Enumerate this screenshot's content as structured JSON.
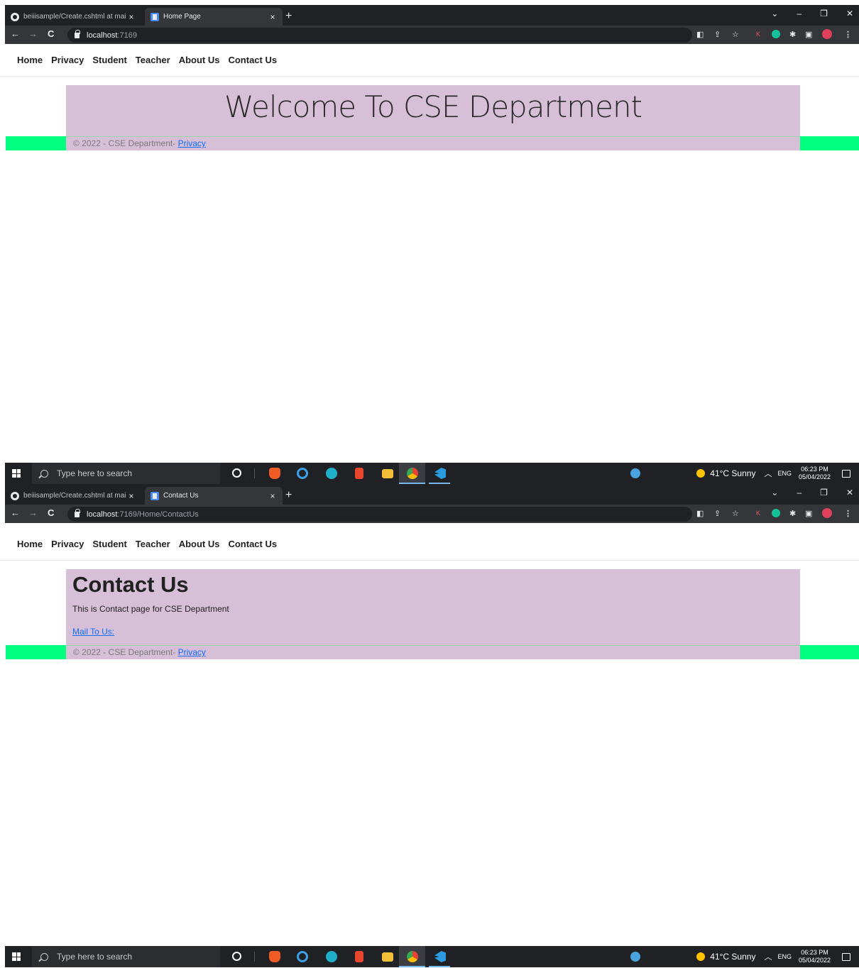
{
  "browser": {
    "inactive_tab_title": "beiiisample/Create.cshtml at mai",
    "new_tab_glyph": "+",
    "close_glyph": "×",
    "window_controls": [
      "⌄",
      "–",
      "❐",
      "✕"
    ]
  },
  "site": {
    "nav": [
      "Home",
      "Privacy",
      "Student",
      "Teacher",
      "About Us",
      "Contact Us"
    ],
    "footer_prefix": "© 2022 - CSE Department-",
    "footer_link": "Privacy",
    "nav_bg_color": "#ffffff",
    "content_bg_color": "#d8bfd8",
    "footer_bg_color": "#00ff7f"
  },
  "screens": [
    {
      "tab_title": "Home Page",
      "url_host": "localhost",
      "url_path": ":7169",
      "heading": "Welcome To CSE Department"
    },
    {
      "tab_title": "Contact Us",
      "url_host": "localhost",
      "url_path": ":7169/Home/ContactUs",
      "heading": "Contact Us",
      "text": "This is Contact page for CSE Department",
      "mail_link": "Mail To Us:"
    }
  ],
  "taskbar": {
    "search_placeholder": "Type here to search",
    "weather": "41°C  Sunny",
    "lang": "ENG",
    "time": "06:23 PM",
    "date": "05/04/2022",
    "icons": [
      "windows-start-icon",
      "search-icon",
      "cortana-icon",
      "brave-icon",
      "internet-explorer-icon",
      "edge-icon",
      "office-icon",
      "file-explorer-icon",
      "chrome-icon",
      "vscode-icon",
      "help-icon",
      "weather-sun-icon",
      "notification-icon"
    ]
  }
}
